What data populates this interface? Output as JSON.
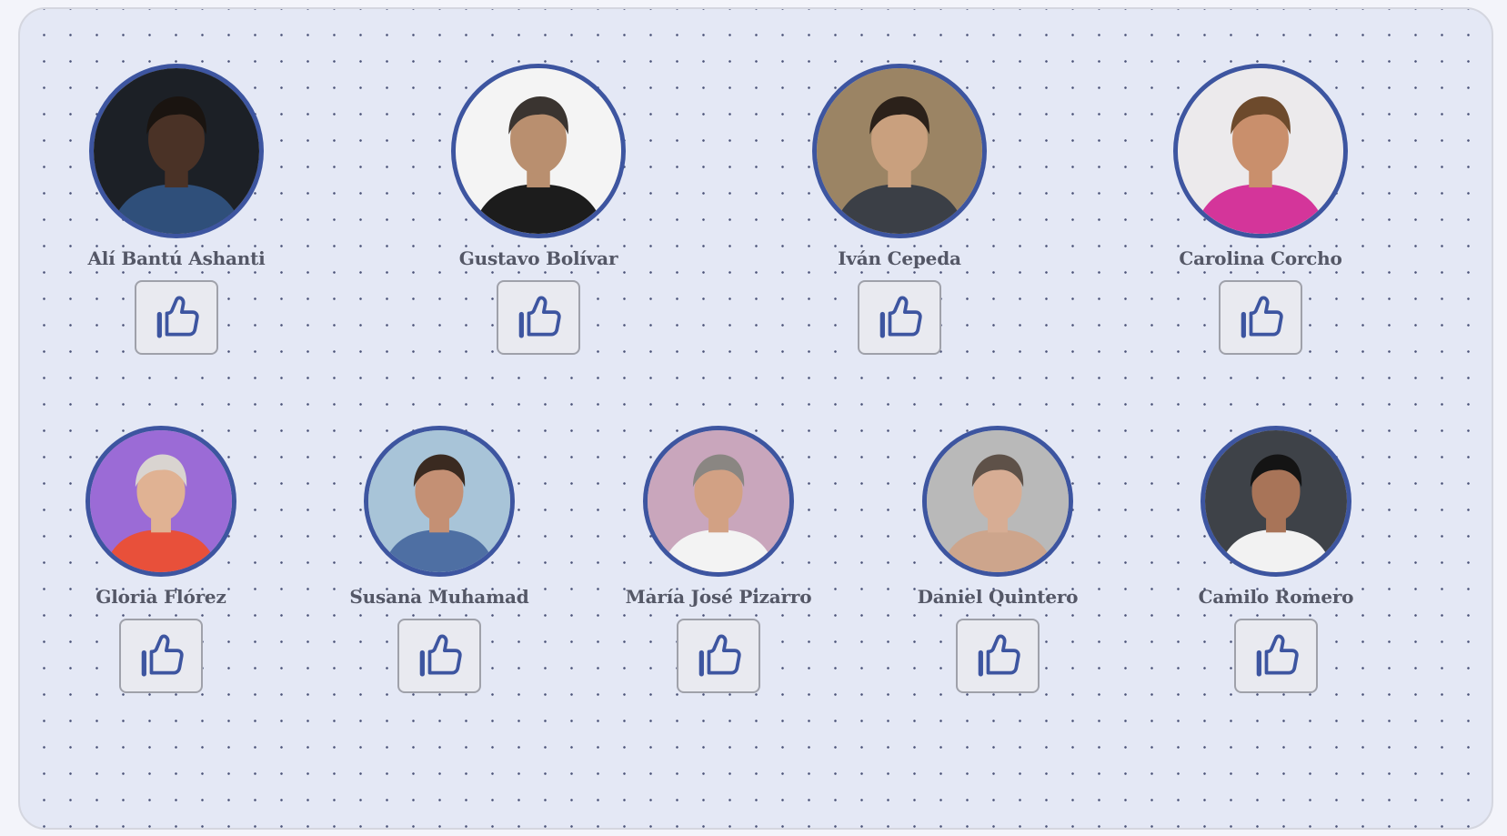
{
  "rows": [
    {
      "candidates": [
        {
          "name": "Alí Bantú Ashanti",
          "bg": "#1c2026",
          "skin": "#4a3226",
          "hair": "#1a1410",
          "cloth": "#2f4f7a"
        },
        {
          "name": "Gustavo Bolívar",
          "bg": "#f4f4f4",
          "skin": "#b98f6f",
          "hair": "#3a3430",
          "cloth": "#1c1c1c"
        },
        {
          "name": "Iván Cepeda",
          "bg": "#9b8464",
          "skin": "#c9a07e",
          "hair": "#2b211a",
          "cloth": "#3b3f46"
        },
        {
          "name": "Carolina Corcho",
          "bg": "#eceaec",
          "skin": "#c98f6c",
          "hair": "#6d4a2c",
          "cloth": "#d4359a"
        }
      ]
    },
    {
      "candidates": [
        {
          "name": "Gloria Flórez",
          "bg": "#9b6bd6",
          "skin": "#e0b293",
          "hair": "#d9d4d0",
          "cloth": "#e8503a"
        },
        {
          "name": "Susana Muhamad",
          "bg": "#a8c4d8",
          "skin": "#c49074",
          "hair": "#3a2a20",
          "cloth": "#4e6fa3"
        },
        {
          "name": "María José Pizarro",
          "bg": "#c9a6bc",
          "skin": "#d2a184",
          "hair": "#8a8682",
          "cloth": "#f3f3f3"
        },
        {
          "name": "Daniel Quintero",
          "bg": "#b9b9b9",
          "skin": "#d7ad94",
          "hair": "#5e5148",
          "cloth": "#cda58c"
        },
        {
          "name": "Camilo Romero",
          "bg": "#3e4248",
          "skin": "#a87458",
          "hair": "#141414",
          "cloth": "#f2f2f2"
        }
      ]
    }
  ],
  "like_icon": "thumbs-up-icon",
  "colors": {
    "accent": "#3d55a0",
    "panel_bg": "#e4e8f5",
    "name_text": "#545766"
  }
}
